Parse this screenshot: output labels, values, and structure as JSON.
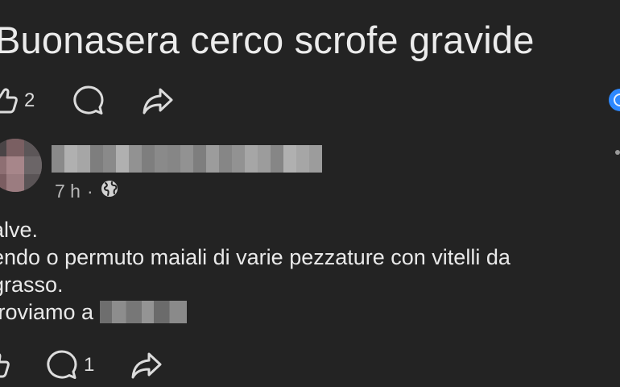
{
  "post": {
    "title": "Buonasera cerco scrofe gravide",
    "likes_count": "2"
  },
  "comment": {
    "timestamp": "7 h",
    "separator": "·",
    "visibility_icon": "globe-icon",
    "lines": [
      "alve.",
      "endo o permuto maiali di varie pezzature con vitelli da",
      "grasso.",
      "troviamo a"
    ],
    "comments_count": "1"
  },
  "icons": {
    "like": "thumbs-up-icon",
    "comment": "comment-bubble-icon",
    "share": "share-arrow-icon"
  },
  "colors": {
    "background": "#232323",
    "text": "#e9e9e9",
    "muted": "#b8b8b8",
    "accent": "#2d88ff"
  }
}
